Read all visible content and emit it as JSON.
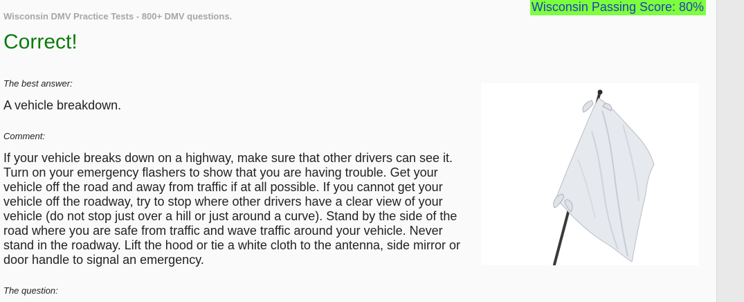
{
  "header": {
    "site_title": "Wisconsin DMV Practice Tests - 800+ DMV questions.",
    "passing_score": "Wisconsin Passing Score: 80%"
  },
  "result": {
    "title": "Correct!"
  },
  "answer": {
    "label": "The best answer:",
    "text": "A vehicle breakdown."
  },
  "comment": {
    "label": "Comment:",
    "text": "If your vehicle breaks down on a highway, make sure that other drivers can see it. Turn on your emergency flashers to show that you are having trouble. Get your vehicle off the road and away from traffic if at all possible. If you cannot get your vehicle off the roadway, try to stop where other drivers have a clear view of your vehicle (do not stop just over a hill or just around a curve). Stand by the side of the road where you are safe from traffic and wave traffic around your vehicle. Never stand in the roadway. Lift the hood or tie a white cloth to the antenna, side mirror or door handle to signal an emergency."
  },
  "question": {
    "label": "The question:"
  },
  "image": {
    "subject": "white-flag"
  },
  "colors": {
    "correct": "#0b7a0b",
    "score_bg": "#7cff3c",
    "score_text": "#1f3fb8",
    "header_text": "#a6a6a6"
  }
}
